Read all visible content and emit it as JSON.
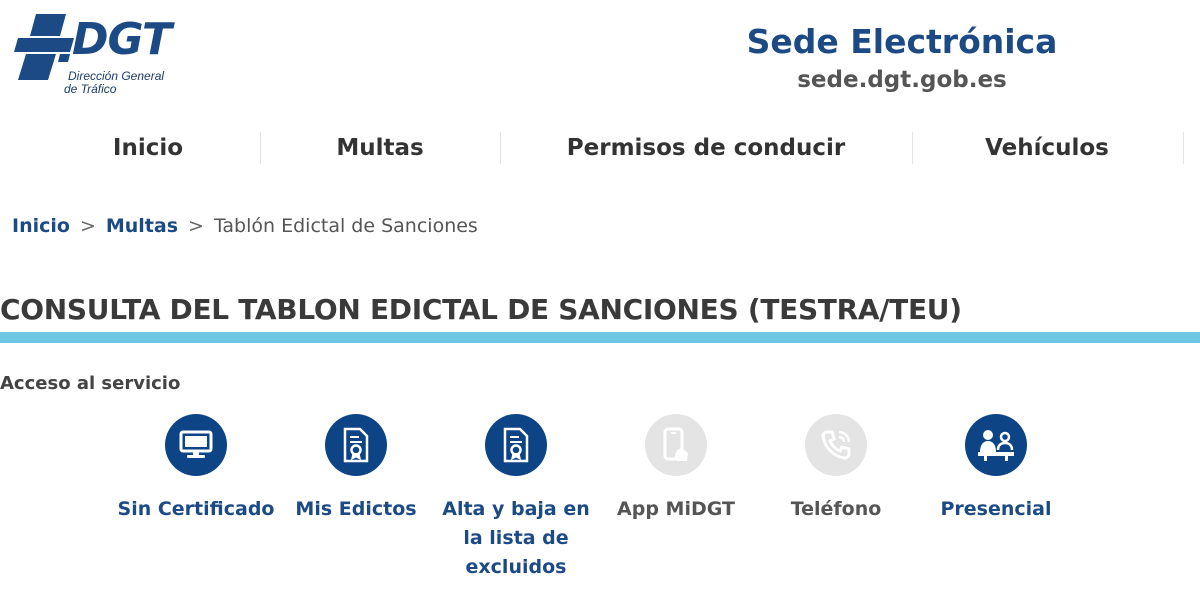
{
  "header": {
    "logo_text": "DGT",
    "logo_sub_line1": "Dirección General",
    "logo_sub_line2": "de Tráfico",
    "site_title": "Sede Electrónica",
    "site_url": "sede.dgt.gob.es"
  },
  "nav": {
    "items": [
      {
        "label": "Inicio"
      },
      {
        "label": "Multas"
      },
      {
        "label": "Permisos de conducir"
      },
      {
        "label": "Vehículos"
      }
    ]
  },
  "breadcrumb": {
    "items": [
      "Inicio",
      "Multas",
      "Tablón Edictal de Sanciones"
    ],
    "separator": ">"
  },
  "page": {
    "title": "CONSULTA DEL TABLON EDICTAL DE SANCIONES (TESTRA/TEU)",
    "section_label": "Acceso al servicio"
  },
  "services": [
    {
      "label": "Sin Certificado",
      "icon": "monitor-icon",
      "enabled": true
    },
    {
      "label": "Mis Edictos",
      "icon": "certificate-document-icon",
      "enabled": true
    },
    {
      "label": "Alta y baja en la lista de excluidos",
      "icon": "certificate-document-icon",
      "enabled": true
    },
    {
      "label": "App MiDGT",
      "icon": "smartphone-icon",
      "enabled": false
    },
    {
      "label": "Teléfono",
      "icon": "phone-icon",
      "enabled": false
    },
    {
      "label": "Presencial",
      "icon": "service-desk-icon",
      "enabled": true
    }
  ],
  "colors": {
    "brand_blue": "#1b4a85",
    "accent_cyan": "#6ec8e4",
    "icon_active": "#0d4486",
    "icon_disabled": "#e4e4e4"
  }
}
